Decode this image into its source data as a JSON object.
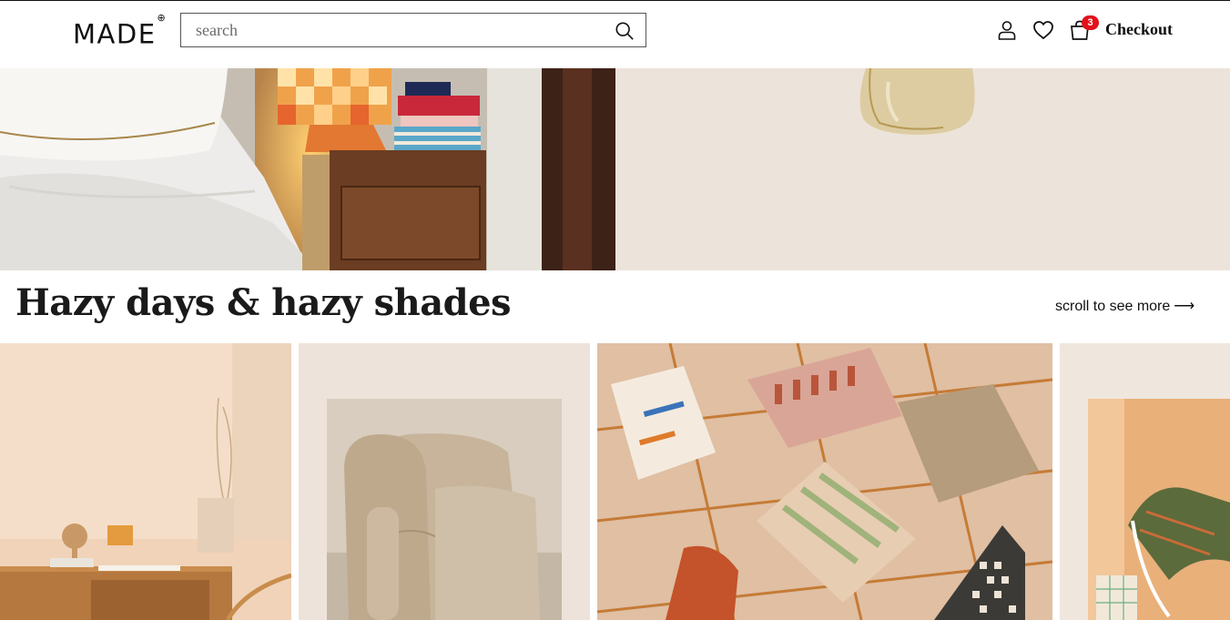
{
  "header": {
    "logo_text": "MADE",
    "logo_mark": "⊕",
    "search_placeholder": "search",
    "search_icon": "search-icon",
    "account_icon": "user-icon",
    "wishlist_icon": "heart-icon",
    "cart_icon": "shopping-bag-icon",
    "cart_count": "3",
    "checkout_label": "Checkout"
  },
  "section": {
    "title": "Hazy days & hazy shades",
    "scroll_label": "scroll to see more",
    "arrow": "⟶"
  },
  "colors": {
    "badge": "#e3101b",
    "hero_right_bg": "#ede3d9"
  }
}
